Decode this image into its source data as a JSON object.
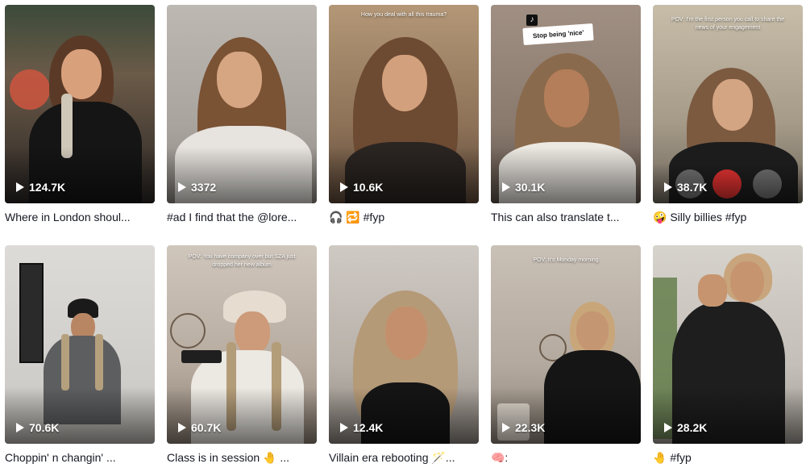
{
  "videos": [
    {
      "views": "124.7K",
      "desc": "Where in London shoul..."
    },
    {
      "views": "3372",
      "desc": "#ad I find that the @lore..."
    },
    {
      "views": "10.6K",
      "desc": "🎧 🔁 #fyp",
      "overlay": "How you deal with all this trauma?"
    },
    {
      "views": "30.1K",
      "desc": "This can also translate t...",
      "caption": "Stop being 'nice'"
    },
    {
      "views": "38.7K",
      "desc": "🤪 Silly billies #fyp",
      "overlay": "POV: I'm the first person you call to share the news of your engagement"
    },
    {
      "views": "70.6K",
      "desc": "Choppin' n changin' ..."
    },
    {
      "views": "60.7K",
      "desc": "Class is in session 🤚 ...",
      "overlay": "POV: You have company over but SZA just dropped her new album"
    },
    {
      "views": "12.4K",
      "desc": "Villain era rebooting 🪄..."
    },
    {
      "views": "22.3K",
      "desc": "🧠:",
      "overlay": "POV: It's Monday morning"
    },
    {
      "views": "28.2K",
      "desc": "🤚 #fyp"
    }
  ],
  "colors": {
    "accent": "#fe2c55",
    "text": "#161823"
  }
}
